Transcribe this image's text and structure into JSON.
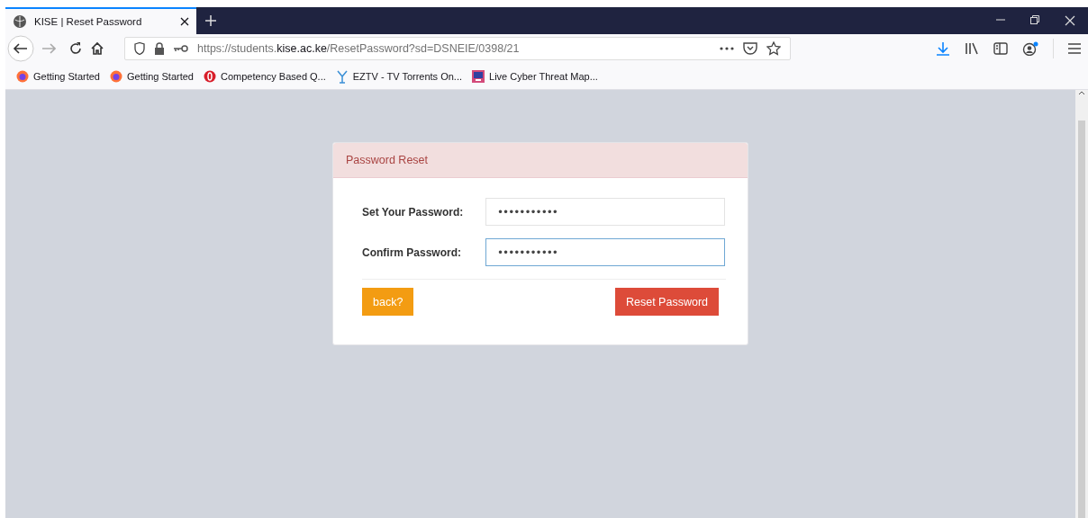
{
  "tabs": [
    {
      "title": "KISE | Reset Password",
      "selected": true
    }
  ],
  "address_bar": {
    "url": "https://students.**kise.ac.ke**/ResetPassword?sd=DSNEIE/0398/21"
  },
  "bookmarks": [
    {
      "label": "Getting Started",
      "kind": "firefox"
    },
    {
      "label": "Getting Started",
      "kind": "firefox"
    },
    {
      "label": "Competency Based Q...",
      "kind": "opera"
    },
    {
      "label": "EZTV - TV Torrents On...",
      "kind": "eztv"
    },
    {
      "label": "Live Cyber Threat Map...",
      "kind": "monitor"
    }
  ],
  "panel": {
    "title": "Password Reset",
    "fields": [
      {
        "label": "Set Your Password:",
        "value": "•••••••••••",
        "focused": false
      },
      {
        "label": "Confirm Password:",
        "value": "•••••••••••",
        "focused": true
      }
    ],
    "buttons": [
      {
        "label": "back?",
        "kind": "warning"
      },
      {
        "label": "Reset Password",
        "kind": "danger"
      }
    ]
  }
}
